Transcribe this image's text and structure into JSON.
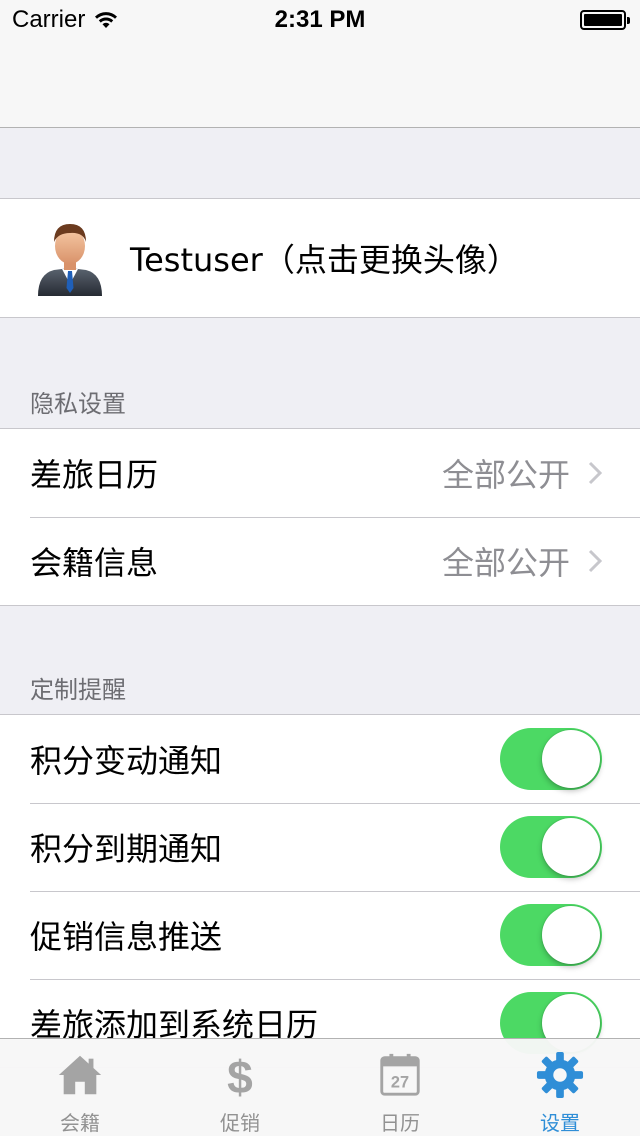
{
  "status_bar": {
    "carrier": "Carrier",
    "time": "2:31 PM"
  },
  "profile": {
    "name": "Testuser（点击更换头像）",
    "avatar_icon": "user-avatar-icon"
  },
  "privacy": {
    "header": "隐私设置",
    "rows": [
      {
        "label": "差旅日历",
        "value": "全部公开"
      },
      {
        "label": "会籍信息",
        "value": "全部公开"
      }
    ]
  },
  "reminders": {
    "header": "定制提醒",
    "rows": [
      {
        "label": "积分变动通知",
        "on": true
      },
      {
        "label": "积分到期通知",
        "on": true
      },
      {
        "label": "促销信息推送",
        "on": true
      },
      {
        "label": "差旅添加到系统日历",
        "on": true
      }
    ]
  },
  "tab_bar": {
    "tabs": [
      {
        "label": "会籍",
        "icon": "home-icon",
        "active": false
      },
      {
        "label": "促销",
        "icon": "dollar-icon",
        "active": false
      },
      {
        "label": "日历",
        "icon": "calendar-icon",
        "active": false,
        "calendar_day": "27"
      },
      {
        "label": "设置",
        "icon": "gear-icon",
        "active": true
      }
    ]
  },
  "colors": {
    "switch_on": "#4cd964",
    "tab_active": "#2f8ed7",
    "tab_inactive": "#929292",
    "secondary_text": "#8e8e93"
  }
}
